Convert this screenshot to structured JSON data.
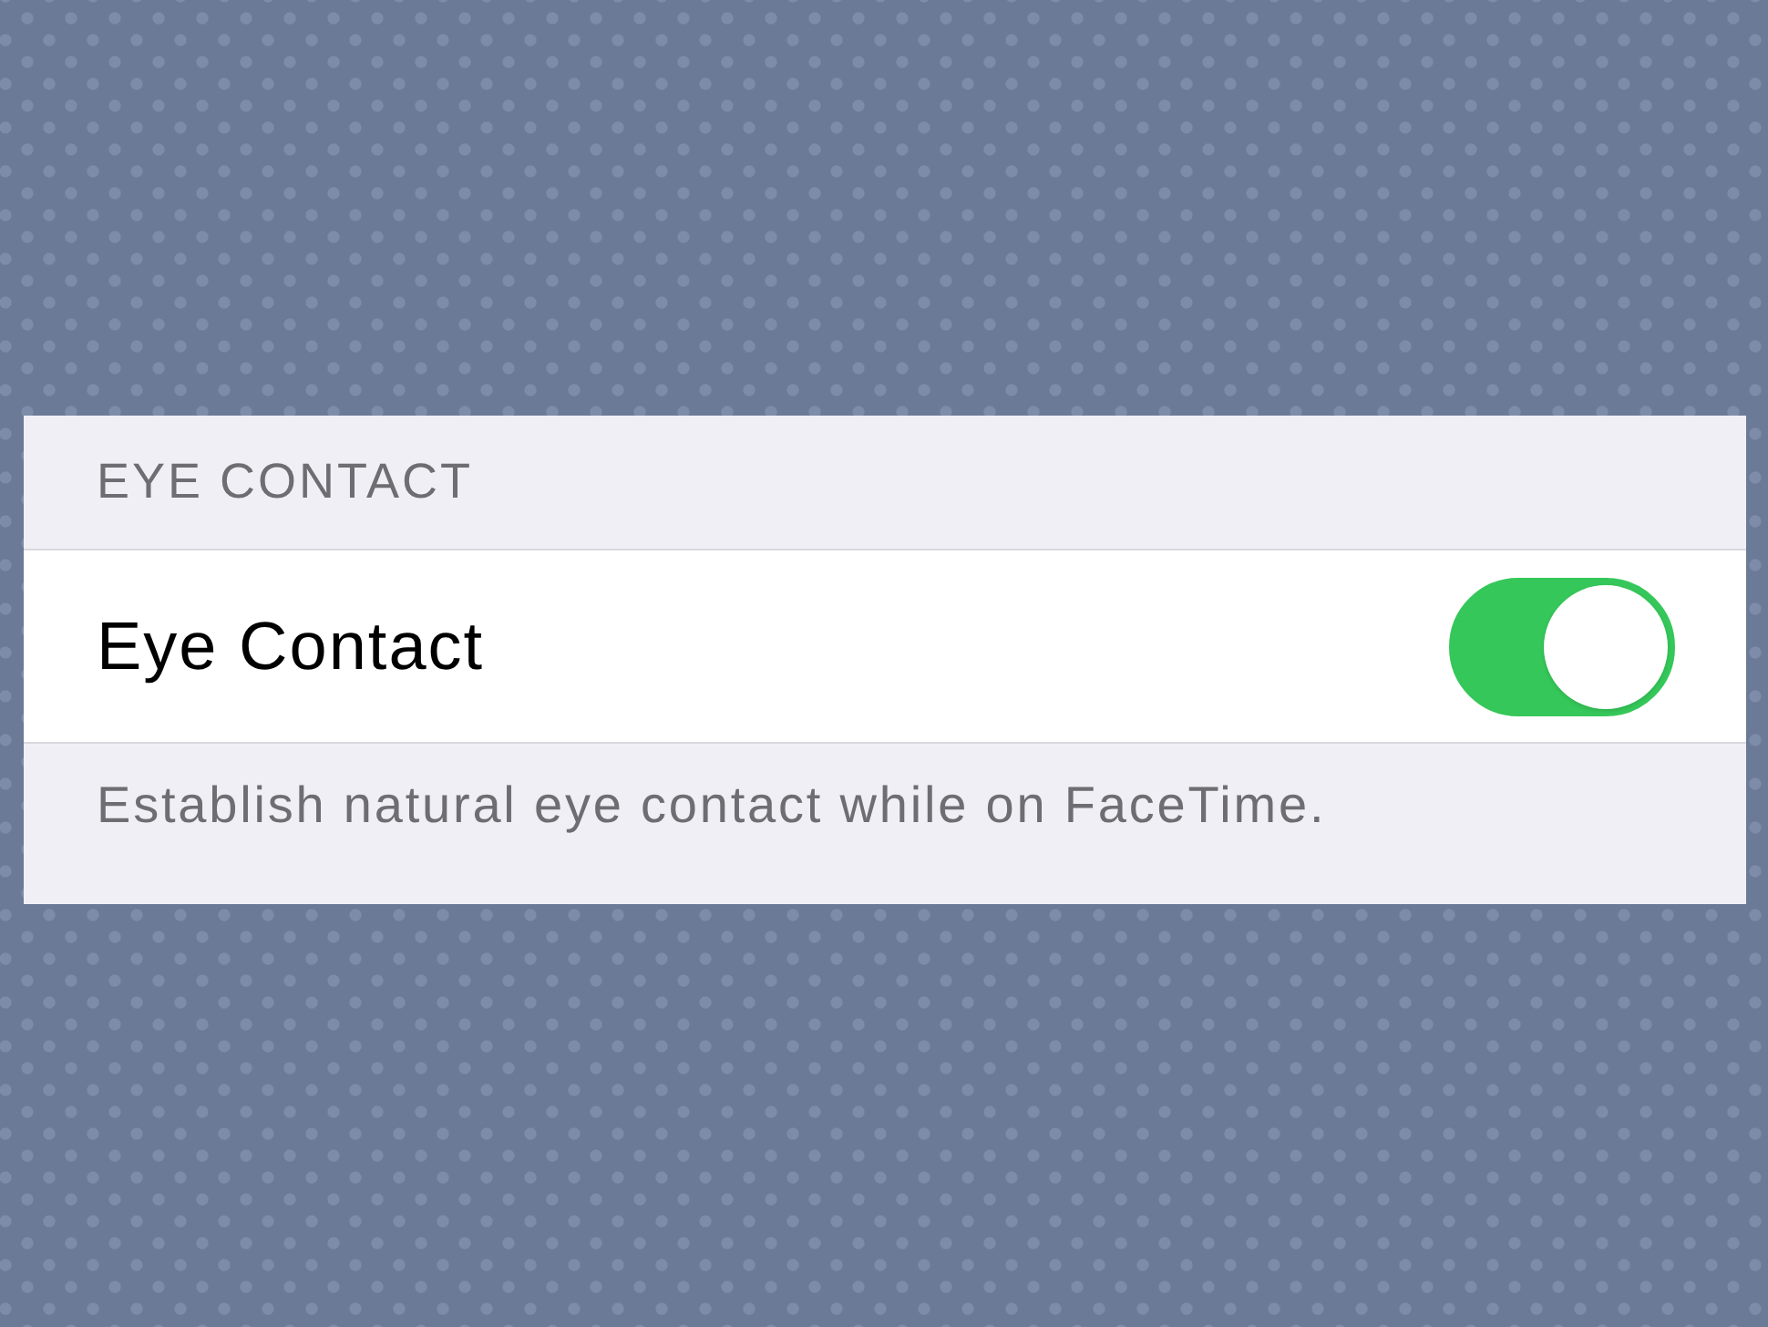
{
  "section": {
    "header": "EYE CONTACT",
    "rows": [
      {
        "kind": "toggle",
        "label": "Eye Contact",
        "on": true
      }
    ],
    "footer": "Establish natural eye contact while on FaceTime."
  }
}
